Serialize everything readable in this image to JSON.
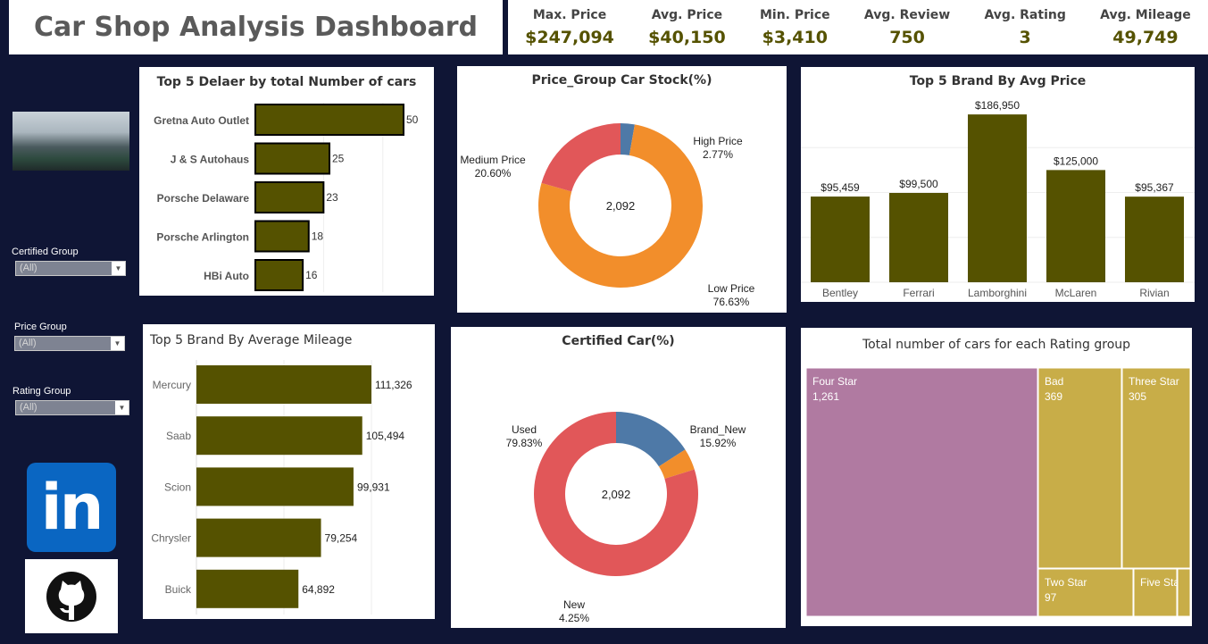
{
  "header": {
    "title": "Car Shop Analysis Dashboard"
  },
  "kpis": [
    {
      "label": "Max. Price",
      "value": "$247,094"
    },
    {
      "label": "Avg. Price",
      "value": "$40,150"
    },
    {
      "label": "Min. Price",
      "value": "$3,410"
    },
    {
      "label": "Avg. Review",
      "value": "750"
    },
    {
      "label": "Avg. Rating",
      "value": "3"
    },
    {
      "label": "Avg. Mileage",
      "value": "49,749"
    }
  ],
  "filters": [
    {
      "label": "Certified Group",
      "value": "(All)"
    },
    {
      "label": "Price Group",
      "value": "(All)"
    },
    {
      "label": "Rating Group",
      "value": "(All)"
    }
  ],
  "links": {
    "linkedin_text": "in"
  },
  "colors": {
    "bar": "#555200",
    "blue": "#4e79a7",
    "orange": "#f28e2b",
    "red": "#e15759",
    "purple": "#b07aa1",
    "gold": "#c8ad48"
  },
  "chart_data": [
    {
      "id": "dealers",
      "type": "bar",
      "orientation": "horizontal",
      "title": "Top 5 Delaer  by total Number of cars",
      "categories": [
        "Gretna Auto Outlet",
        "J & S Autohaus",
        "Porsche Delaware",
        "Porsche Arlington",
        "HBi Auto"
      ],
      "values": [
        50,
        25,
        23,
        18,
        16
      ],
      "labels": [
        "50",
        "25",
        "23",
        "18",
        "16"
      ]
    },
    {
      "id": "price_group",
      "type": "pie",
      "title": "Price_Group Car Stock(%)",
      "center_label": "2,092",
      "slices": [
        {
          "name": "High Price",
          "value": 2.77,
          "label": "2.77%"
        },
        {
          "name": "Low Price",
          "value": 76.63,
          "label": "76.63%"
        },
        {
          "name": "Medium Price",
          "value": 20.6,
          "label": "20.60%"
        }
      ]
    },
    {
      "id": "brand_price",
      "type": "bar",
      "title": "Top 5 Brand By Avg Price",
      "categories": [
        "Bentley",
        "Ferrari",
        "Lamborghini",
        "McLaren",
        "Rivian"
      ],
      "values": [
        95459,
        99500,
        186950,
        125000,
        95367
      ],
      "labels": [
        "$95,459",
        "$99,500",
        "$186,950",
        "$125,000",
        "$95,367"
      ],
      "ylim": [
        0,
        200000
      ]
    },
    {
      "id": "brand_mileage",
      "type": "bar",
      "orientation": "horizontal",
      "title": "Top 5 Brand By Average Mileage",
      "categories": [
        "Mercury",
        "Saab",
        "Scion",
        "Chrysler",
        "Buick"
      ],
      "values": [
        111326,
        105494,
        99931,
        79254,
        64892
      ],
      "labels": [
        "111,326",
        "105,494",
        "99,931",
        "79,254",
        "64,892"
      ]
    },
    {
      "id": "certified",
      "type": "pie",
      "title": "Certified Car(%)",
      "center_label": "2,092",
      "slices": [
        {
          "name": "Brand_New",
          "value": 15.92,
          "label": "15.92%"
        },
        {
          "name": "New",
          "value": 4.25,
          "label": "4.25%"
        },
        {
          "name": "Used",
          "value": 79.83,
          "label": "79.83%"
        }
      ]
    },
    {
      "id": "rating",
      "type": "treemap",
      "title": "Total number of cars for each Rating group",
      "items": [
        {
          "name": "Four Star",
          "value": 1261,
          "label": "1,261"
        },
        {
          "name": "Bad",
          "value": 369,
          "label": "369"
        },
        {
          "name": "Three Star",
          "value": 305,
          "label": "305"
        },
        {
          "name": "Two Star",
          "value": 97,
          "label": "97"
        },
        {
          "name": "Five Star",
          "value": 60,
          "label": ""
        }
      ]
    }
  ]
}
